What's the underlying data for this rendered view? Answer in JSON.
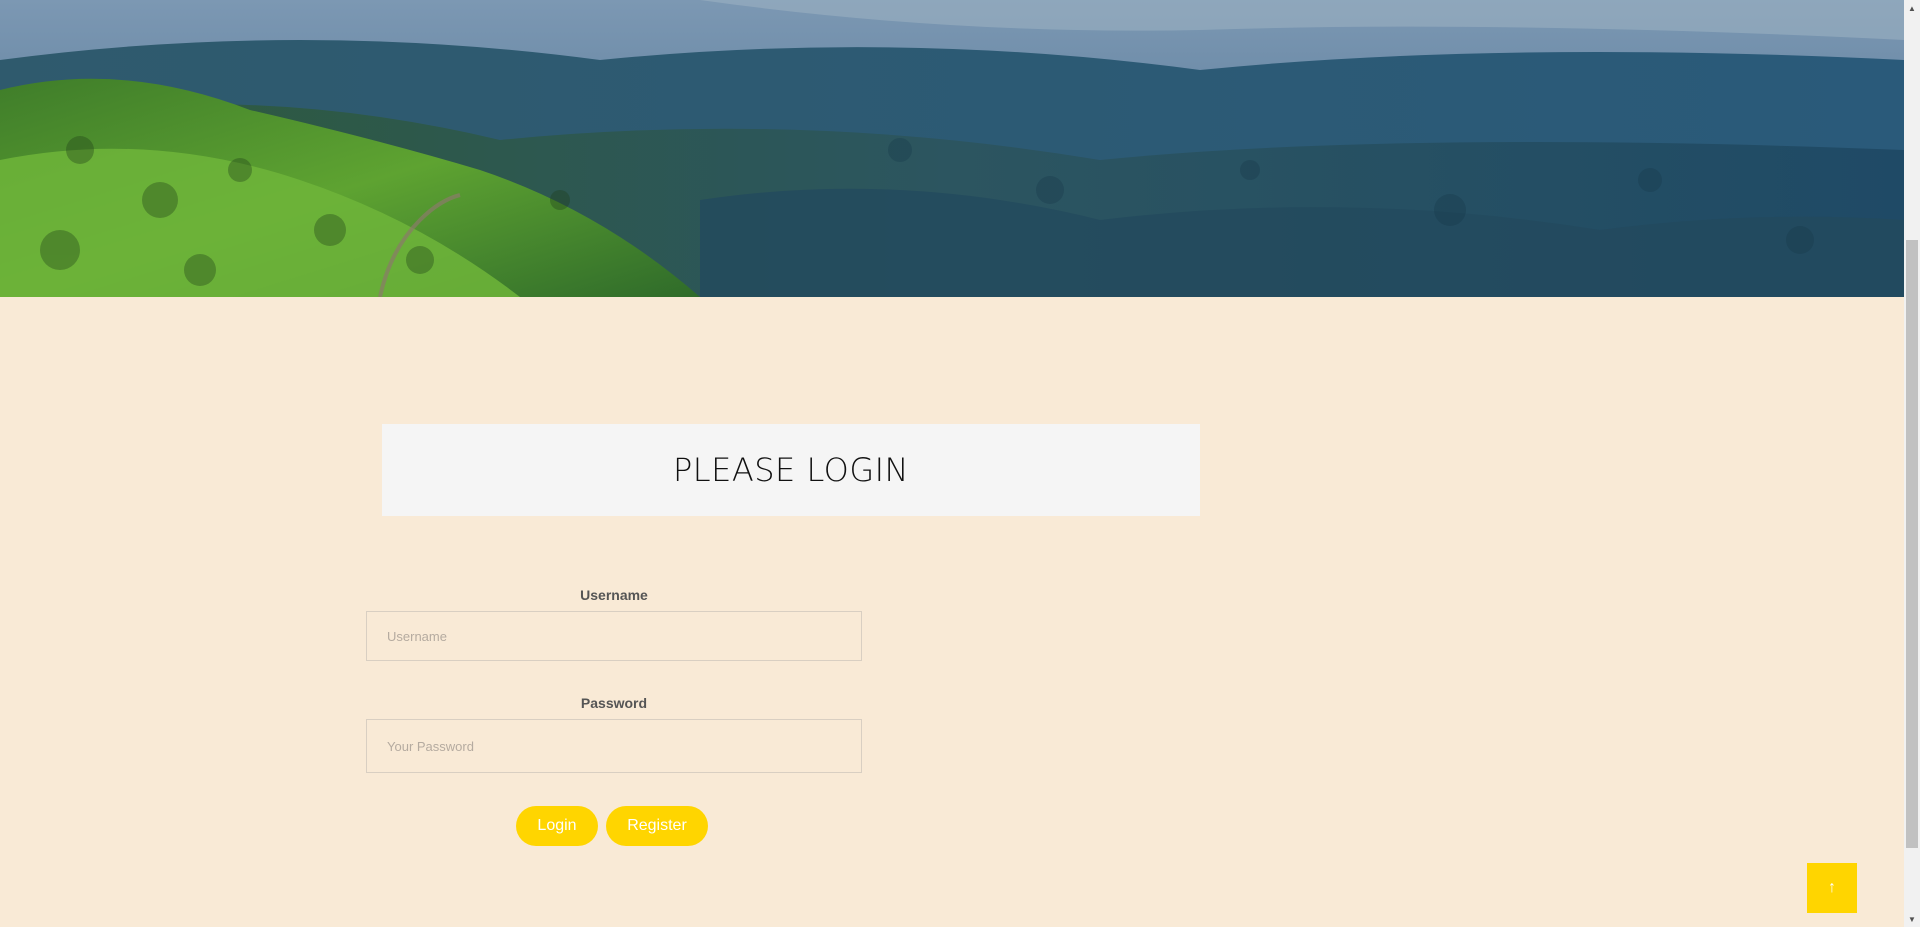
{
  "hero": {
    "image_name": "forest-mountains-landscape"
  },
  "login": {
    "title": "PLEASE LOGIN",
    "username_label": "Username",
    "username_placeholder": "Username",
    "username_value": "",
    "password_label": "Password",
    "password_placeholder": "Your Password",
    "password_value": "",
    "login_button": "Login",
    "register_button": "Register"
  },
  "scroll_top": {
    "icon": "arrow-up-icon",
    "glyph": "↑"
  },
  "colors": {
    "background": "#f9ead6",
    "accent": "#ffd500",
    "header_box": "#f5f5f5"
  }
}
